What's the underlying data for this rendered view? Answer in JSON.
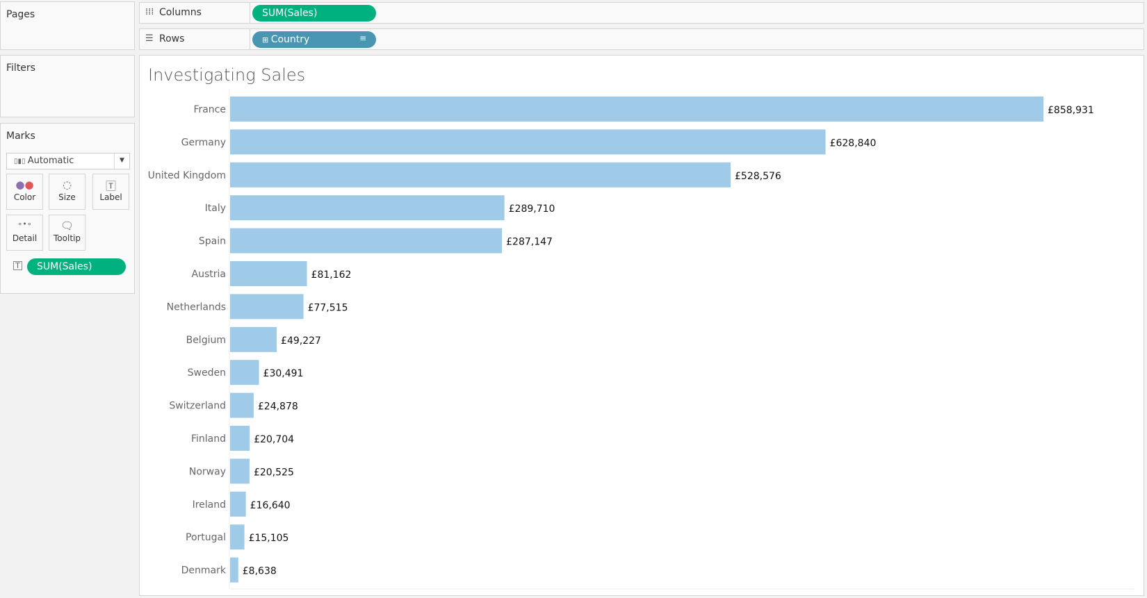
{
  "panels": {
    "pages": "Pages",
    "filters": "Filters",
    "marks": "Marks"
  },
  "marks": {
    "type": "Automatic",
    "buttons": [
      "Color",
      "Size",
      "Label",
      "Detail",
      "Tooltip"
    ],
    "label_pill": "SUM(Sales)"
  },
  "shelves": {
    "columns_label": "Columns",
    "columns_pill": "SUM(Sales)",
    "rows_label": "Rows",
    "rows_pill": "Country"
  },
  "colors": {
    "bar": "#a0cbe8",
    "green_pill": "#00b180",
    "blue_pill": "#4996b2"
  },
  "chart_data": {
    "type": "bar",
    "orientation": "horizontal",
    "title": "Investigating Sales",
    "categories": [
      "France",
      "Germany",
      "United Kingdom",
      "Italy",
      "Spain",
      "Austria",
      "Netherlands",
      "Belgium",
      "Sweden",
      "Switzerland",
      "Finland",
      "Norway",
      "Ireland",
      "Portugal",
      "Denmark"
    ],
    "values": [
      858931,
      628840,
      528576,
      289710,
      287147,
      81162,
      77515,
      49227,
      30491,
      24878,
      20704,
      20525,
      16640,
      15105,
      8638
    ],
    "labels": [
      "£858,931",
      "£628,840",
      "£528,576",
      "£289,710",
      "£287,147",
      "£81,162",
      "£77,515",
      "£49,227",
      "£30,491",
      "£24,878",
      "£20,704",
      "£20,525",
      "£16,640",
      "£15,105",
      "£8,638"
    ],
    "grid": false
  }
}
